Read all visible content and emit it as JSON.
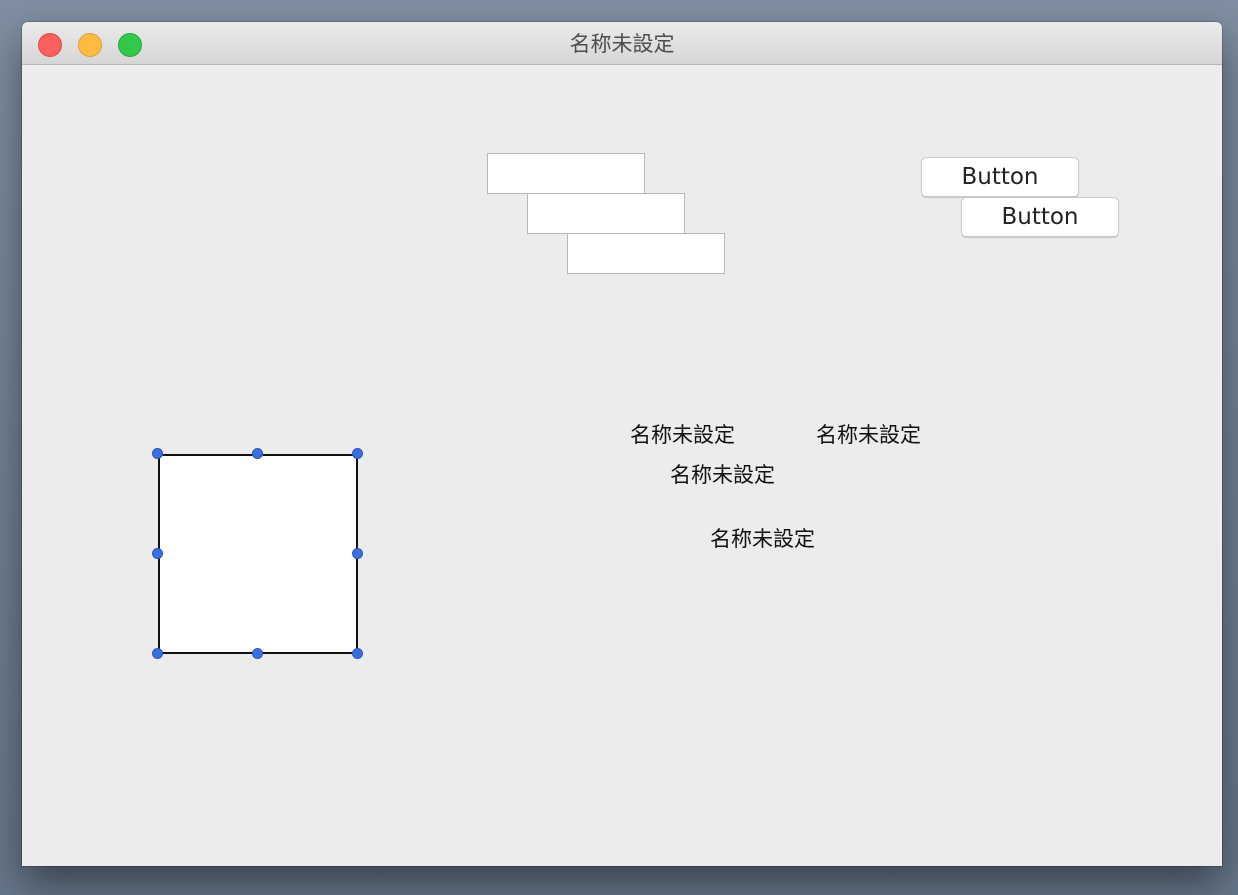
{
  "window": {
    "title": "名称未設定"
  },
  "text_fields": [
    {
      "value": ""
    },
    {
      "value": ""
    },
    {
      "value": ""
    }
  ],
  "buttons": [
    {
      "label": "Button"
    },
    {
      "label": "Button"
    }
  ],
  "labels": [
    {
      "text": "名称未設定"
    },
    {
      "text": "名称未設定"
    },
    {
      "text": "名称未設定"
    },
    {
      "text": "名称未設定"
    }
  ],
  "colors": {
    "selection_handle": "#3b6fe0",
    "close": "#fc605c",
    "minimize": "#fdbc40",
    "zoom": "#34c84a"
  }
}
